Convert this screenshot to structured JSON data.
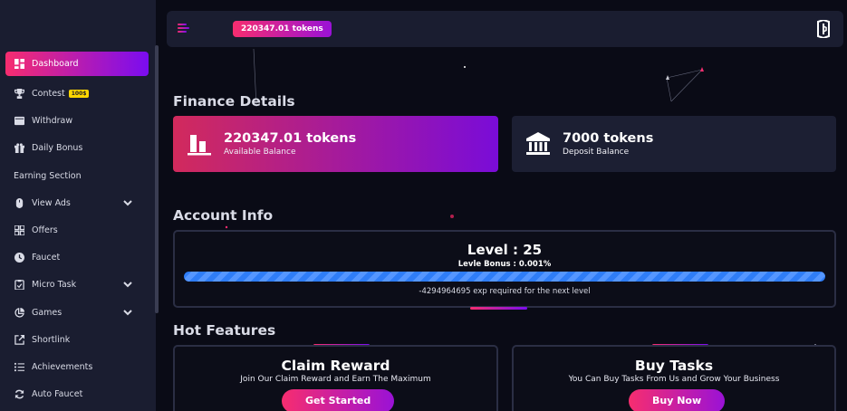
{
  "topbar": {
    "tokens": "220347.01 tokens"
  },
  "sidebar": {
    "items": [
      {
        "label": "Dashboard",
        "icon": "dashboard-icon",
        "active": true
      },
      {
        "label": "Contest",
        "icon": "trophy-icon",
        "badge": "100$"
      },
      {
        "label": "Withdraw",
        "icon": "wallet-icon"
      },
      {
        "label": "Daily Bonus",
        "icon": "gift-icon"
      },
      {
        "label": "View Ads",
        "icon": "mouse-icon",
        "expandable": true
      },
      {
        "label": "Offers",
        "icon": "grid-icon"
      },
      {
        "label": "Faucet",
        "icon": "clock-icon"
      },
      {
        "label": "Micro Task",
        "icon": "clipboard-icon",
        "expandable": true
      },
      {
        "label": "Games",
        "icon": "pie-icon",
        "expandable": true
      },
      {
        "label": "Shortlink",
        "icon": "external-link-icon"
      },
      {
        "label": "Achievements",
        "icon": "list-icon"
      },
      {
        "label": "Auto Faucet",
        "icon": "refresh-icon"
      }
    ],
    "section_label": "Earning Section"
  },
  "finance": {
    "title": "Finance Details",
    "available_value": "220347.01 tokens",
    "available_label": "Available Balance",
    "deposit_value": "7000 tokens",
    "deposit_label": "Deposit Balance"
  },
  "account": {
    "title": "Account Info",
    "level": "Level : 25",
    "bonus": "Levle Bonus : 0.001%",
    "progress_percent": 100,
    "exp_text": "-4294964695 exp required for the next level"
  },
  "features": {
    "title": "Hot Features",
    "cards": [
      {
        "title": "Claim Reward",
        "desc": "Join Our Claim Reward and Earn The Maximum",
        "button": "Get Started"
      },
      {
        "title": "Buy Tasks",
        "desc": "You Can Buy Tasks From Us and Grow Your Business",
        "button": "Buy Now"
      }
    ]
  },
  "colors": {
    "accent_start": "#f72d6f",
    "accent_end": "#7a0cf0",
    "panel": "#1a1d30",
    "background": "#0a0b16",
    "progress": "#2f7df7",
    "badge": "#ffd600"
  }
}
